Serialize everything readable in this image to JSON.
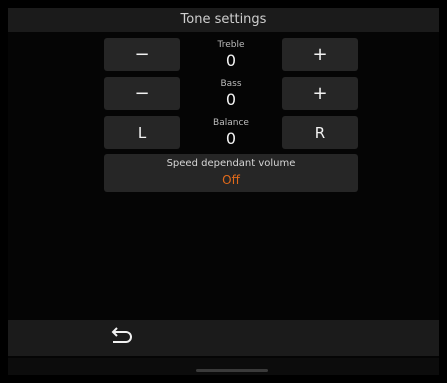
{
  "title": "Tone settings",
  "treble": {
    "label": "Treble",
    "value": "0",
    "minus": "−",
    "plus": "+"
  },
  "bass": {
    "label": "Bass",
    "value": "0",
    "minus": "−",
    "plus": "+"
  },
  "balance": {
    "label": "Balance",
    "value": "0",
    "left": "L",
    "right": "R"
  },
  "speed_volume": {
    "label": "Speed dependant volume",
    "value": "Off",
    "value_color": "#e0691a"
  },
  "bottom_bar": {
    "back_icon": "back-arrow-icon"
  }
}
